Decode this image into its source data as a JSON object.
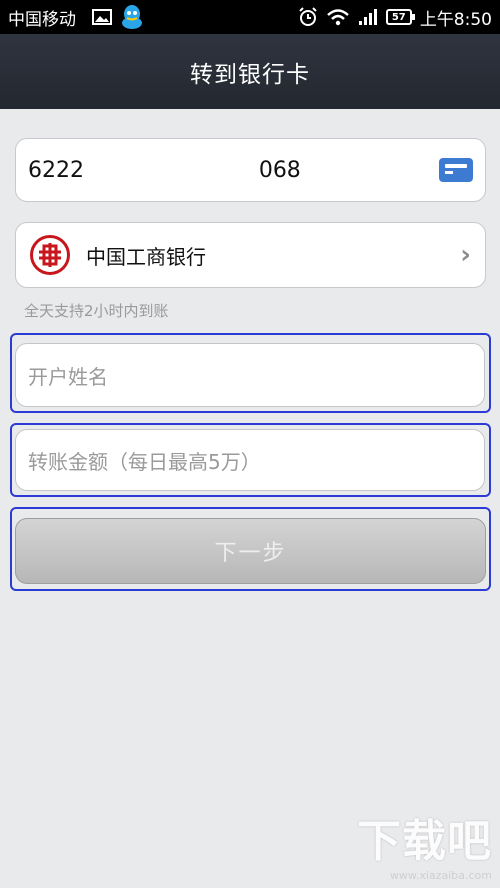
{
  "status_bar": {
    "carrier": "中国移动",
    "battery": "57",
    "time": "上午8:50"
  },
  "header": {
    "title": "转到银行卡"
  },
  "card_number": {
    "value": "6222                         068"
  },
  "bank": {
    "name": "中国工商银行"
  },
  "note": "全天支持2小时内到账",
  "fields": {
    "account_name_placeholder": "开户姓名",
    "amount_placeholder": "转账金额（每日最高5万）"
  },
  "next_button": {
    "label": "下一步"
  },
  "watermark": {
    "brand": "下载吧",
    "url": "www.xiazaiba.com"
  },
  "colors": {
    "header": "#2a2f38",
    "accent": "#3d7bd2",
    "highlight": "#2c3bd6",
    "bank_red": "#c8161d"
  }
}
